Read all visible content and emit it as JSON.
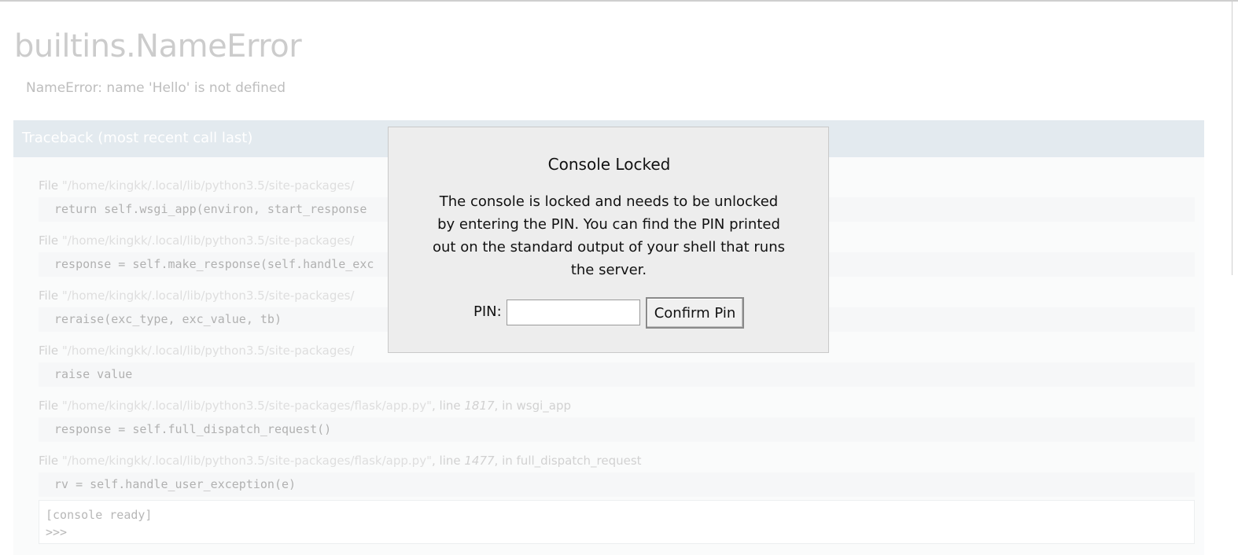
{
  "error": {
    "title": "builtins.NameError",
    "message": "NameError: name 'Hello' is not defined"
  },
  "traceback": {
    "title": "Traceback",
    "subtitle": "(most recent call last)",
    "frames": [
      {
        "file_prefix": "File ",
        "path": "\"/home/kingkk/.local/lib/python3.5/site-packages/",
        "line_label": "",
        "line_no": "",
        "in_label": "",
        "func": "",
        "code": "return self.wsgi_app(environ, start_response"
      },
      {
        "file_prefix": "File ",
        "path": "\"/home/kingkk/.local/lib/python3.5/site-packages/",
        "line_label": "",
        "line_no": "",
        "in_label": "",
        "func": "",
        "code": "response = self.make_response(self.handle_exc"
      },
      {
        "file_prefix": "File ",
        "path": "\"/home/kingkk/.local/lib/python3.5/site-packages/",
        "line_label": "",
        "line_no": "",
        "in_label": "",
        "func": "",
        "code": "reraise(exc_type, exc_value, tb)"
      },
      {
        "file_prefix": "File ",
        "path": "\"/home/kingkk/.local/lib/python3.5/site-packages/",
        "line_label": "",
        "line_no": "",
        "in_label": "",
        "func": "",
        "code": "raise value"
      },
      {
        "file_prefix": "File ",
        "path": "\"/home/kingkk/.local/lib/python3.5/site-packages/flask/app.py\"",
        "line_label": ", line ",
        "line_no": "1817",
        "in_label": ", in ",
        "func": "wsgi_app",
        "code": "response = self.full_dispatch_request()"
      },
      {
        "file_prefix": "File ",
        "path": "\"/home/kingkk/.local/lib/python3.5/site-packages/flask/app.py\"",
        "line_label": ", line ",
        "line_no": "1477",
        "in_label": ", in ",
        "func": "full_dispatch_request",
        "code": "rv = self.handle_user_exception(e)"
      }
    ]
  },
  "console": {
    "status": "[console ready]",
    "prompt": ">>>"
  },
  "dialog": {
    "title": "Console Locked",
    "text": "The console is locked and needs to be unlocked by entering the PIN. You can find the PIN printed out on the standard output of your shell that runs the server.",
    "pin_label": "PIN:",
    "pin_value": "",
    "confirm_label": "Confirm Pin"
  }
}
